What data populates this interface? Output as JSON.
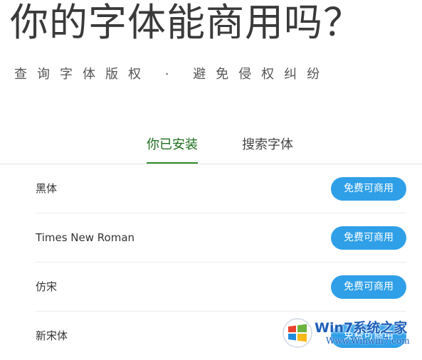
{
  "hero": {
    "title": "你的字体能商用吗？",
    "subtitle": "查询字体版权 · 避免侵权纠纷"
  },
  "tabs": [
    {
      "label": "你已安装",
      "active": true
    },
    {
      "label": "搜索字体",
      "active": false
    }
  ],
  "fonts": [
    {
      "name": "黑体",
      "license_label": "免费可商用"
    },
    {
      "name": "Times New Roman",
      "license_label": "免费可商用"
    },
    {
      "name": "仿宋",
      "license_label": "免费可商用"
    },
    {
      "name": "新宋体",
      "license_label": "免费可商用"
    }
  ],
  "watermark": {
    "brand": "Win7系统之家",
    "url": "Www.Winwin7.com"
  },
  "colors": {
    "accent_green": "#2e8b2e",
    "button_blue": "#2f9fe8"
  }
}
